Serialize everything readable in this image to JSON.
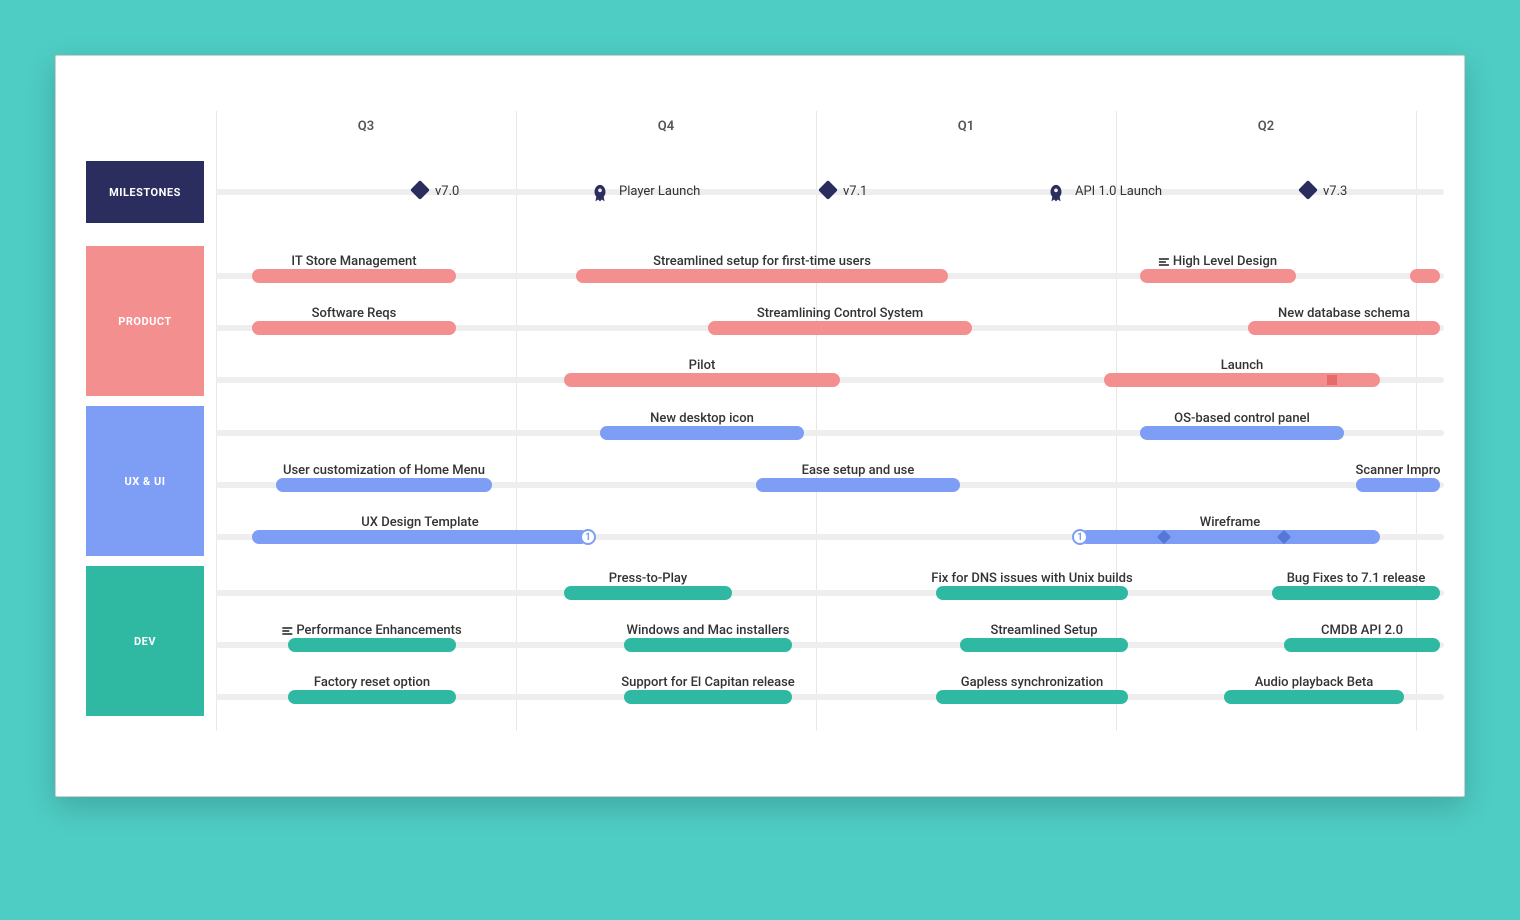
{
  "quarters": [
    "Q3",
    "Q4",
    "Q1",
    "Q2"
  ],
  "lanes": {
    "milestones": "MILESTONES",
    "product": "PRODUCT",
    "ux": "UX & UI",
    "dev": "DEV"
  },
  "milestones": [
    {
      "label": "v7.0",
      "pos": 17,
      "icon": "diamond"
    },
    {
      "label": "Player Launch",
      "pos": 32,
      "icon": "rocket"
    },
    {
      "label": "v7.1",
      "pos": 51,
      "icon": "diamond"
    },
    {
      "label": "API 1.0 Launch",
      "pos": 70,
      "icon": "rocket"
    },
    {
      "label": "v7.3",
      "pos": 91,
      "icon": "diamond"
    }
  ],
  "product": [
    {
      "row": 0,
      "label": "IT Store Management",
      "start": 3,
      "end": 20
    },
    {
      "row": 0,
      "label": "Streamlined setup for first-time users",
      "start": 30,
      "end": 61
    },
    {
      "row": 0,
      "label": "High Level Design",
      "start": 77,
      "end": 90,
      "prefixIcon": "list"
    },
    {
      "row": 0,
      "label": "",
      "start": 99.5,
      "end": 102
    },
    {
      "row": 1,
      "label": "Software Reqs",
      "start": 3,
      "end": 20
    },
    {
      "row": 1,
      "label": "Streamlining Control System",
      "start": 41,
      "end": 63
    },
    {
      "row": 1,
      "label": "New database schema",
      "start": 86,
      "end": 102
    },
    {
      "row": 2,
      "label": "Pilot",
      "start": 29,
      "end": 52
    },
    {
      "row": 2,
      "label": "Launch",
      "start": 74,
      "end": 97,
      "marker": "square",
      "markerPos": 93
    }
  ],
  "ux": [
    {
      "row": 0,
      "label": "New desktop icon",
      "start": 32,
      "end": 49
    },
    {
      "row": 0,
      "label": "OS-based control panel",
      "start": 77,
      "end": 94
    },
    {
      "row": 1,
      "label": "User customization of Home Menu",
      "start": 5,
      "end": 23
    },
    {
      "row": 1,
      "label": "Ease setup and use",
      "start": 45,
      "end": 62
    },
    {
      "row": 1,
      "label": "Scanner Impro",
      "start": 95,
      "end": 102
    },
    {
      "row": 2,
      "label": "UX Design Template",
      "start": 3,
      "end": 31,
      "badge": "1",
      "badgePos": 31
    },
    {
      "row": 2,
      "label": "Wireframe",
      "start": 72,
      "end": 97,
      "badge": "1",
      "badgePos": 72,
      "diamonds": [
        79,
        89
      ]
    }
  ],
  "dev": [
    {
      "row": 0,
      "label": "Press-to-Play",
      "start": 29,
      "end": 43
    },
    {
      "row": 0,
      "label": "Fix for DNS issues with Unix builds",
      "start": 60,
      "end": 76
    },
    {
      "row": 0,
      "label": "Bug Fixes to 7.1 release",
      "start": 88,
      "end": 102
    },
    {
      "row": 1,
      "label": "Performance Enhancements",
      "start": 6,
      "end": 20,
      "prefixIcon": "list"
    },
    {
      "row": 1,
      "label": "Windows and Mac installers",
      "start": 34,
      "end": 48
    },
    {
      "row": 1,
      "label": "Streamlined Setup",
      "start": 62,
      "end": 76
    },
    {
      "row": 1,
      "label": "CMDB API 2.0",
      "start": 89,
      "end": 102
    },
    {
      "row": 2,
      "label": "Factory reset option",
      "start": 6,
      "end": 20
    },
    {
      "row": 2,
      "label": "Support for El Capitan release",
      "start": 34,
      "end": 48
    },
    {
      "row": 2,
      "label": "Gapless synchronization",
      "start": 60,
      "end": 76
    },
    {
      "row": 2,
      "label": "Audio playback Beta",
      "start": 84,
      "end": 99
    }
  ],
  "chart_data": {
    "type": "gantt-roadmap",
    "time_axis": [
      "Q3",
      "Q4",
      "Q1",
      "Q2"
    ],
    "swimlanes": [
      {
        "name": "MILESTONES",
        "color": "#2a2d5e",
        "items": [
          {
            "type": "milestone",
            "label": "v7.0",
            "quarter": "Q3",
            "icon": "diamond"
          },
          {
            "type": "milestone",
            "label": "Player Launch",
            "quarter": "Q4",
            "icon": "rocket"
          },
          {
            "type": "milestone",
            "label": "v7.1",
            "quarter": "Q4",
            "icon": "diamond"
          },
          {
            "type": "milestone",
            "label": "API 1.0 Launch",
            "quarter": "Q1",
            "icon": "rocket"
          },
          {
            "type": "milestone",
            "label": "v7.3",
            "quarter": "Q2",
            "icon": "diamond"
          }
        ]
      },
      {
        "name": "PRODUCT",
        "color": "#f48f8f",
        "items": [
          {
            "label": "IT Store Management",
            "start": "Q3",
            "end": "Q3"
          },
          {
            "label": "Streamlined setup for first-time users",
            "start": "Q4",
            "end": "Q1"
          },
          {
            "label": "High Level Design",
            "start": "Q1",
            "end": "Q2"
          },
          {
            "label": "Software Reqs",
            "start": "Q3",
            "end": "Q3"
          },
          {
            "label": "Streamlining Control System",
            "start": "Q4",
            "end": "Q1"
          },
          {
            "label": "New database schema",
            "start": "Q2",
            "end": "Q2"
          },
          {
            "label": "Pilot",
            "start": "Q4",
            "end": "Q4"
          },
          {
            "label": "Launch",
            "start": "Q1",
            "end": "Q2"
          }
        ]
      },
      {
        "name": "UX & UI",
        "color": "#7e9ef5",
        "items": [
          {
            "label": "New desktop icon",
            "start": "Q4",
            "end": "Q4"
          },
          {
            "label": "OS-based control panel",
            "start": "Q1",
            "end": "Q2"
          },
          {
            "label": "User customization of Home Menu",
            "start": "Q3",
            "end": "Q3"
          },
          {
            "label": "Ease setup and use",
            "start": "Q4",
            "end": "Q1"
          },
          {
            "label": "Scanner Impro",
            "start": "Q2",
            "end": "Q2"
          },
          {
            "label": "UX Design Template",
            "start": "Q3",
            "end": "Q4"
          },
          {
            "label": "Wireframe",
            "start": "Q1",
            "end": "Q2"
          }
        ]
      },
      {
        "name": "DEV",
        "color": "#2fb9a3",
        "items": [
          {
            "label": "Press-to-Play",
            "start": "Q4",
            "end": "Q4"
          },
          {
            "label": "Fix for DNS issues with Unix builds",
            "start": "Q1",
            "end": "Q1"
          },
          {
            "label": "Bug Fixes to 7.1 release",
            "start": "Q2",
            "end": "Q2"
          },
          {
            "label": "Performance Enhancements",
            "start": "Q3",
            "end": "Q3"
          },
          {
            "label": "Windows and Mac installers",
            "start": "Q4",
            "end": "Q4"
          },
          {
            "label": "Streamlined Setup",
            "start": "Q1",
            "end": "Q1"
          },
          {
            "label": "CMDB API 2.0",
            "start": "Q2",
            "end": "Q2"
          },
          {
            "label": "Factory reset option",
            "start": "Q3",
            "end": "Q3"
          },
          {
            "label": "Support for El Capitan release",
            "start": "Q4",
            "end": "Q4"
          },
          {
            "label": "Gapless synchronization",
            "start": "Q1",
            "end": "Q1"
          },
          {
            "label": "Audio playback Beta",
            "start": "Q2",
            "end": "Q2"
          }
        ]
      }
    ]
  }
}
